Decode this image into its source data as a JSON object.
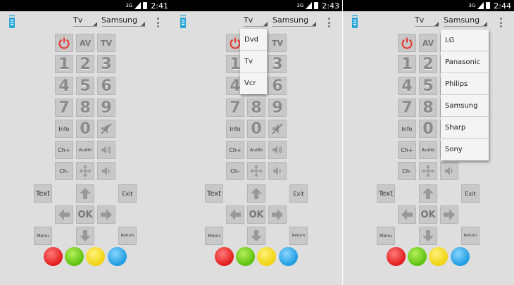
{
  "panels": [
    {
      "time": "2:41",
      "device": "Tv",
      "brand": "Samsung"
    },
    {
      "time": "2:43",
      "device": "Tv",
      "brand": "Samsung",
      "device_menu": [
        "Dvd",
        "Tv",
        "Vcr"
      ]
    },
    {
      "time": "2:44",
      "device": "Tv",
      "brand": "Samsung",
      "brand_menu": [
        "LG",
        "Panasonic",
        "Philips",
        "Samsung",
        "Sharp",
        "Sony"
      ]
    }
  ],
  "status": {
    "signal": "3G"
  },
  "keys": {
    "av": "AV",
    "tv": "TV",
    "d1": "1",
    "d2": "2",
    "d3": "3",
    "d4": "4",
    "d5": "5",
    "d6": "6",
    "d7": "7",
    "d8": "8",
    "d9": "9",
    "info": "Info",
    "d0": "0",
    "chup": "Ch+",
    "audio": "Audio",
    "chdown": "Ch-",
    "text": "Text",
    "exit": "Exit",
    "ok": "OK",
    "menu": "Menu",
    "ret": "Return"
  },
  "colors": {
    "power": "#e8322a",
    "red": "#e21b1b",
    "green": "#59c10d",
    "yellow": "#f0d20c",
    "blue": "#1b9be0"
  },
  "icons": [
    "remote-icon",
    "power-icon",
    "mute-icon",
    "volume-up-icon",
    "volume-down-icon",
    "move-icon",
    "arrow-up-icon",
    "arrow-left-icon",
    "arrow-right-icon",
    "arrow-down-icon",
    "overflow-menu-icon"
  ]
}
